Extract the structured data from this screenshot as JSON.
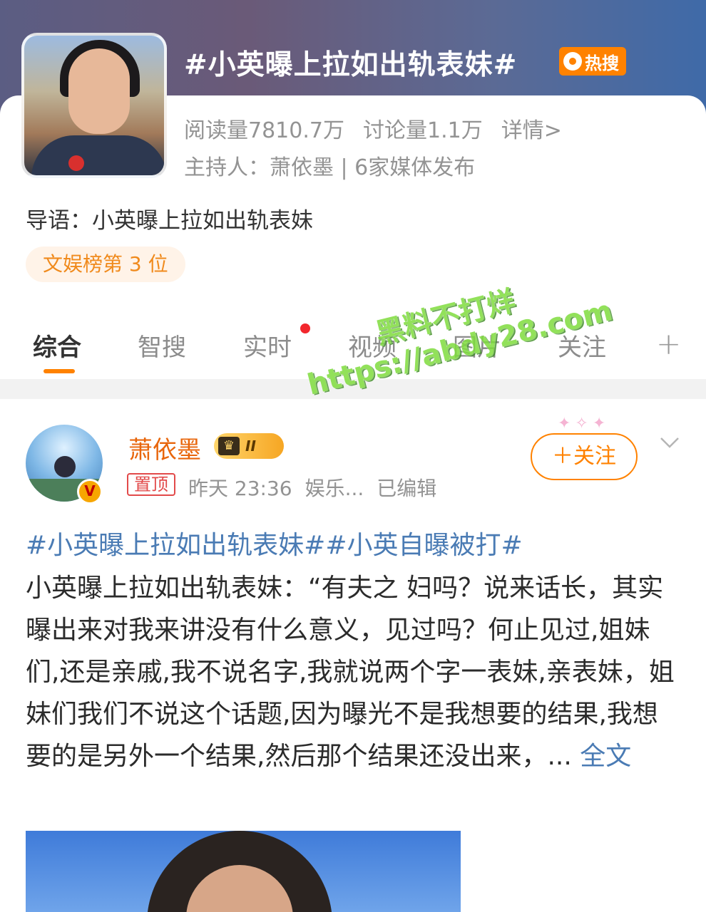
{
  "topic": {
    "title": "#小英曝上拉如出轨表妹#",
    "hot_badge": "热搜",
    "reads": "阅读量7810.7万",
    "discussions": "讨论量1.1万",
    "details_link": "详情>",
    "host": "主持人：萧依墨 | 6家媒体发布",
    "intro": "导语：小英曝上拉如出轨表妹",
    "rank": "文娱榜第 3 位"
  },
  "tabs": [
    {
      "label": "综合",
      "active": true
    },
    {
      "label": "智搜"
    },
    {
      "label": "实时",
      "has_dot": true
    },
    {
      "label": "视频"
    },
    {
      "label": "图片"
    },
    {
      "label": "关注"
    }
  ],
  "tab_more_icon": "plus-icon",
  "post": {
    "author": "萧依墨",
    "level": "II",
    "pin_label": "置顶",
    "time": "昨天 23:36",
    "source": "娱乐...",
    "edited": "已编辑",
    "follow_label": "＋关注",
    "hashtags": "#小英曝上拉如出轨表妹##小英自曝被打#",
    "body": "小英曝上拉如出轨表妹：“有夫之 妇吗？说来话长，其实曝出来对我来讲没有什么意义，见过吗？何止见过,姐妹们,还是亲戚,我不说名字,我就说两个字一表妹,亲表妹，姐妹们我们不说这个话题,因为曝光不是我想要的结果,我想要的是另外一个结果,然后那个结果还没出来，... ",
    "full_text_link": "全文"
  },
  "watermark": {
    "line1": "黑料不打烊",
    "line2": "https://abdy28.com"
  },
  "colors": {
    "accent": "#ff8200",
    "link": "#4a7bb4",
    "author": "#e8660c"
  }
}
